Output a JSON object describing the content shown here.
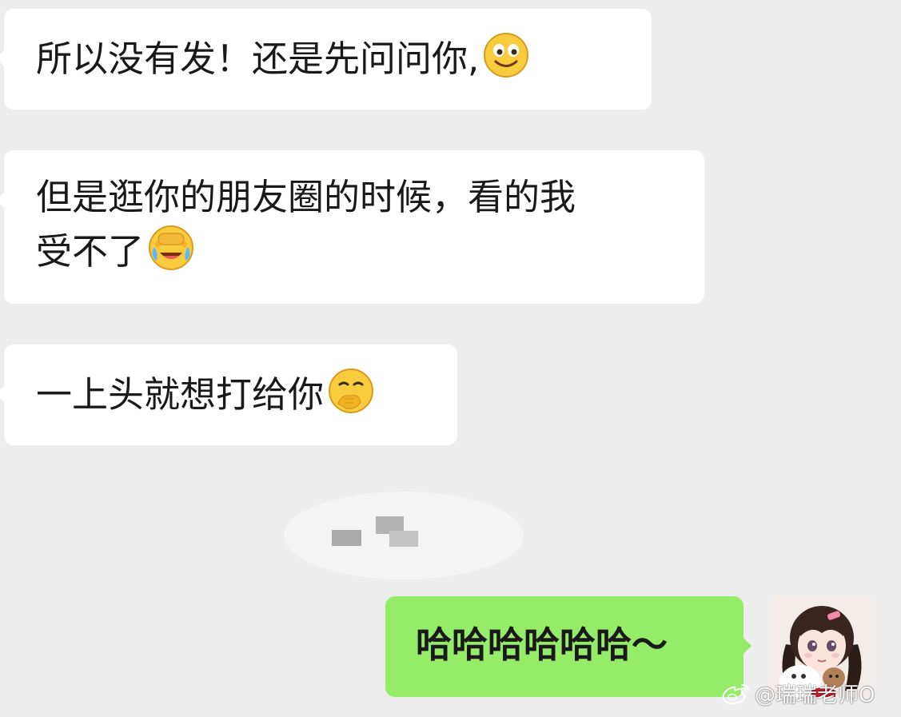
{
  "messages": [
    {
      "id": "msg1",
      "side": "incoming",
      "text": "所以没有发！还是先问问你,",
      "emoji": "smile-emoji"
    },
    {
      "id": "msg2",
      "side": "incoming",
      "line1": "但是逛你的朋友圈的时候，看的我",
      "line2": "受不了",
      "emoji": "facepalm-crying-emoji"
    },
    {
      "id": "msg3",
      "side": "incoming",
      "text": "一上头就想打给你",
      "emoji": "shy-giggle-emoji"
    },
    {
      "id": "msg4",
      "side": "outgoing",
      "text": "哈哈哈哈哈哈～"
    }
  ],
  "redacted_message": {
    "icon": "redacted-pixel-block"
  },
  "avatar": {
    "icon": "user-avatar-girl"
  },
  "watermark": {
    "text": "@瑞瑞老师O",
    "icon": "weibo-logo"
  },
  "colors": {
    "background": "#ededed",
    "incoming_bubble": "#ffffff",
    "outgoing_bubble": "#95ec69",
    "text": "#191919"
  }
}
